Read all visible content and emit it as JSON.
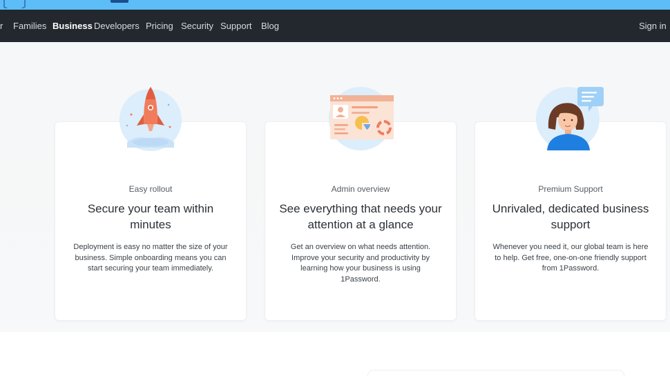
{
  "nav": {
    "items": [
      {
        "label": "r",
        "name": "nav-item-personal"
      },
      {
        "label": "Families",
        "name": "nav-item-families"
      },
      {
        "label": "Business",
        "name": "nav-item-business"
      },
      {
        "label": "Developers",
        "name": "nav-item-developers"
      },
      {
        "label": "Pricing",
        "name": "nav-item-pricing"
      },
      {
        "label": "Security",
        "name": "nav-item-security"
      },
      {
        "label": "Support",
        "name": "nav-item-support"
      },
      {
        "label": "Blog",
        "name": "nav-item-blog"
      }
    ],
    "active": "Business",
    "sign_in": "Sign in"
  },
  "cards": [
    {
      "icon": "rocket-illustration",
      "eyebrow": "Easy rollout",
      "title": "Secure your team within minutes",
      "description": "Deployment is easy no matter the size of your business. Simple onboarding means you can start securing your team immediately."
    },
    {
      "icon": "dashboard-illustration",
      "eyebrow": "Admin overview",
      "title": "See everything that needs your attention at a glance",
      "description": "Get an overview on what needs attention. Improve your security and productivity by learning how your business is using 1Password."
    },
    {
      "icon": "support-agent-illustration",
      "eyebrow": "Premium Support",
      "title": "Unrivaled, dedicated business support",
      "description": "Whenever you need it, our global team is here to help. Get free, one-on-one friendly support from 1Password."
    }
  ],
  "colors": {
    "banner": "#5cbdf7",
    "nav_bg": "#23282e",
    "accent_orange": "#f07c5c",
    "illustration_blue": "#d9ecfb"
  }
}
